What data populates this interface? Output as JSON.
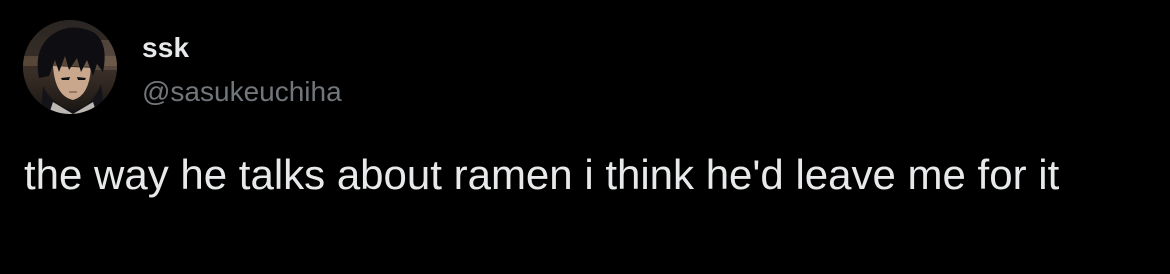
{
  "tweet": {
    "display_name": "ssk",
    "handle": "@sasukeuchiha",
    "text": "the way he talks about ramen i think he'd leave me for it",
    "avatar_icon": "anime-character-avatar"
  },
  "colors": {
    "background": "#000000",
    "primary_text": "#e7e9ea",
    "secondary_text": "#71767b"
  }
}
